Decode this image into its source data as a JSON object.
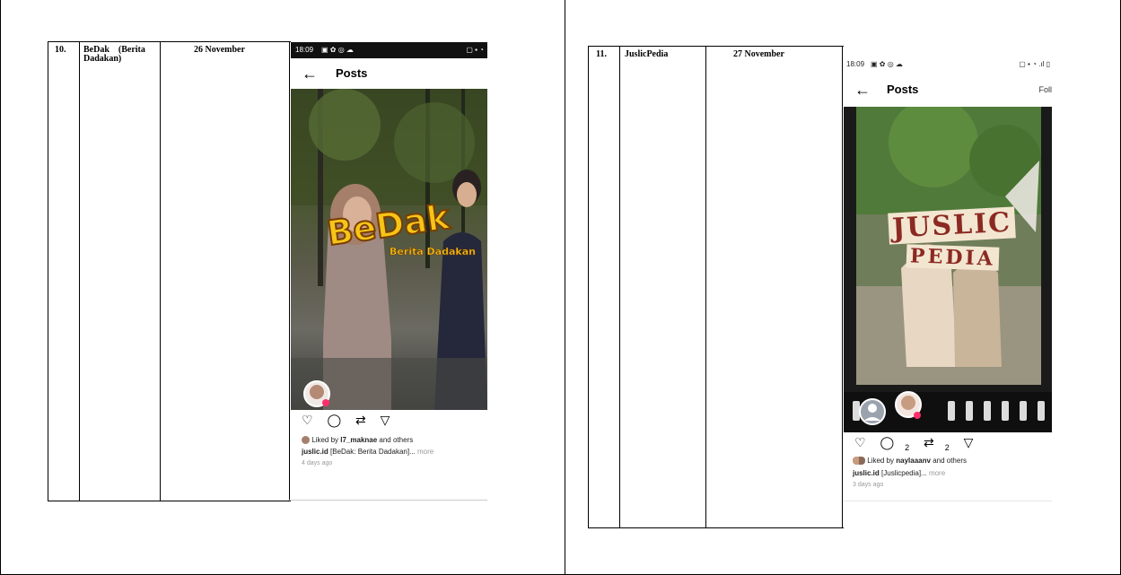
{
  "rows": [
    {
      "number": "10.",
      "title_line1": "BeDak    (Berita",
      "title_line2": "Dadakan)",
      "date": "26 November",
      "phone": {
        "time": "18:09",
        "status_icons": "▣ ✿ ◎ ☁",
        "status_right": "▢ ▪ ◔",
        "back_icon": "←",
        "header_title": "Posts",
        "follow_label": "",
        "overlay_title": "BeDak",
        "overlay_subtitle": "Berita Dadakan",
        "liked_prefix": "Liked by ",
        "liked_user": "l7_maknae",
        "liked_suffix": " and others",
        "caption_user": "juslic.id",
        "caption_text": " [BeDak: Berita Dadakan]...",
        "caption_more": " more",
        "time_ago": "4 days ago",
        "icons": [
          "♡",
          "◯",
          "⇄",
          "▽"
        ]
      }
    },
    {
      "number": "11.",
      "title_line1": "JuslicPedia",
      "date": "27 November",
      "phone": {
        "time": "18:09",
        "status_icons": "▣ ✿ ◎ ☁",
        "status_right": "▢ ▪ ◔ .ıl ▯",
        "back_icon": "←",
        "header_title": "Posts",
        "follow_label": "Foll",
        "overlay_line1": "JUSLIC",
        "overlay_line2": "PEDIA",
        "comment_count": "2",
        "repost_count": "2",
        "liked_prefix": "Liked by ",
        "liked_user": "naylaaanv",
        "liked_suffix": " and others",
        "caption_user": "juslic.id",
        "caption_text": " [Juslicpedia]...",
        "caption_more": " more",
        "time_ago": "3 days ago",
        "icons": [
          "♡",
          "◯",
          "⇄",
          "▽"
        ]
      }
    }
  ],
  "colors": {
    "bedak_yellow": "#f5c518",
    "bedak_outline": "#7a3e00",
    "juslic_red": "#8b2a22",
    "juslic_paper": "#f3e6d1"
  }
}
